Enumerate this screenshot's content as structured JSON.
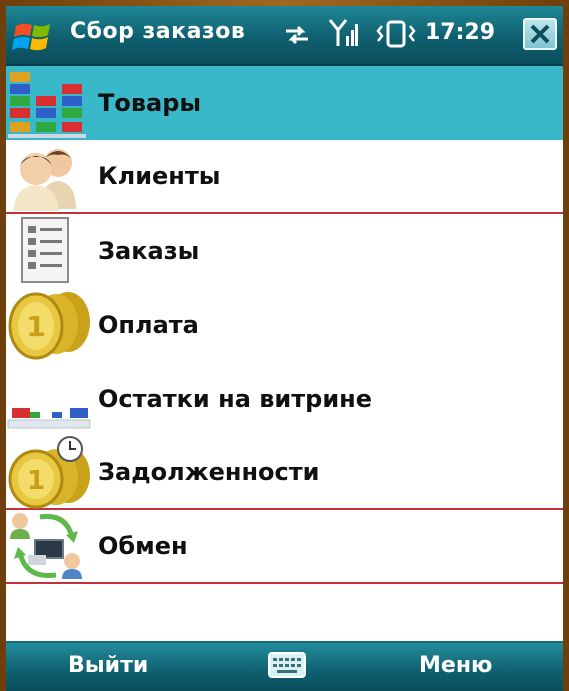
{
  "titlebar": {
    "title": "Сбор заказов",
    "time": "17:29"
  },
  "menu": {
    "items": [
      {
        "label": "Товары",
        "icon": "goods-icon"
      },
      {
        "label": "Клиенты",
        "icon": "clients-icon"
      },
      {
        "label": "Заказы",
        "icon": "orders-icon"
      },
      {
        "label": "Оплата",
        "icon": "coins-icon"
      },
      {
        "label": "Остатки на витрине",
        "icon": "shelf-stock-icon"
      },
      {
        "label": "Задолженности",
        "icon": "coins-clock-icon"
      },
      {
        "label": "Обмен",
        "icon": "exchange-icon"
      }
    ],
    "selected_index": 0
  },
  "softkeys": {
    "left": "Выйти",
    "right": "Меню"
  },
  "colors": {
    "titlebar": "#0f5f6f",
    "selected": "#38b8c8",
    "separator": "#c4303c"
  }
}
